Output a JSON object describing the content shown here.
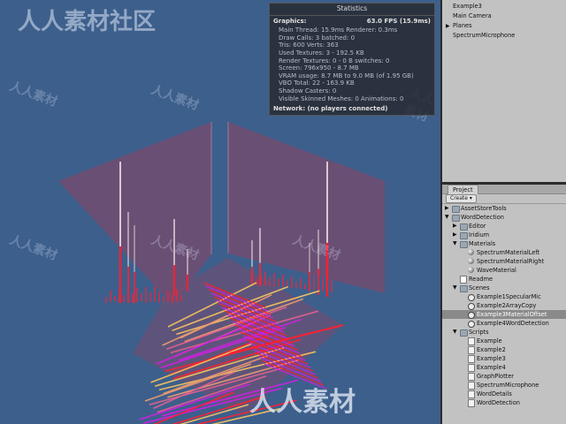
{
  "watermark": {
    "top_left": "人人素材社区",
    "center_bottom": "人人素材",
    "faint": "人人素材"
  },
  "stats": {
    "title": "Statistics",
    "graphics_label": "Graphics:",
    "fps": "63.0 FPS (15.9ms)",
    "lines": [
      "Main Thread: 15.9ms   Renderer: 0.3ms",
      "Draw Calls: 3   batched: 0",
      "Tris: 600   Verts: 363",
      "Used Textures: 3 - 192.5 KB",
      "Render Textures: 0 - 0 B   switches: 0",
      "Screen: 796x950 - 8.7 MB",
      "VRAM usage: 8.7 MB to 9.0 MB (of 1.95 GB)",
      "VBO Total: 22 - 163.9 KB",
      "Shadow Casters: 0",
      "Visible Skinned Meshes: 0       Animations: 0"
    ],
    "network": "Network: (no players connected)"
  },
  "hierarchy": {
    "items": [
      {
        "label": "Example3",
        "expandable": false
      },
      {
        "label": "Main Camera",
        "expandable": false
      },
      {
        "label": "Planes",
        "expandable": true
      },
      {
        "label": "SpectrumMicrophone",
        "expandable": false
      }
    ]
  },
  "project": {
    "tab_label": "Project",
    "create_label": "Create",
    "tree": [
      {
        "label": "AssetStoreTools",
        "depth": 0,
        "icon": "folder-icon",
        "arrow": "right"
      },
      {
        "label": "WordDetection",
        "depth": 0,
        "icon": "folder-icon",
        "arrow": "down"
      },
      {
        "label": "Editor",
        "depth": 1,
        "icon": "folder-icon",
        "arrow": "right"
      },
      {
        "label": "Iridium",
        "depth": 1,
        "icon": "folder-icon",
        "arrow": "right"
      },
      {
        "label": "Materials",
        "depth": 1,
        "icon": "folder-icon",
        "arrow": "down"
      },
      {
        "label": "SpectrumMaterialLeft",
        "depth": 2,
        "icon": "material-icon",
        "arrow": ""
      },
      {
        "label": "SpectrumMaterialRight",
        "depth": 2,
        "icon": "material-icon",
        "arrow": ""
      },
      {
        "label": "WaveMaterial",
        "depth": 2,
        "icon": "material-icon",
        "arrow": ""
      },
      {
        "label": "Readme",
        "depth": 1,
        "icon": "document-icon",
        "arrow": ""
      },
      {
        "label": "Scenes",
        "depth": 1,
        "icon": "folder-icon",
        "arrow": "down"
      },
      {
        "label": "Example1SpecularMic",
        "depth": 2,
        "icon": "scene-icon",
        "arrow": ""
      },
      {
        "label": "Example2ArrayCopy",
        "depth": 2,
        "icon": "scene-icon",
        "arrow": ""
      },
      {
        "label": "Example3MaterialOffset",
        "depth": 2,
        "icon": "scene-icon",
        "arrow": "",
        "selected": true
      },
      {
        "label": "Example4WordDetection",
        "depth": 2,
        "icon": "scene-icon",
        "arrow": ""
      },
      {
        "label": "Scripts",
        "depth": 1,
        "icon": "folder-icon",
        "arrow": "down"
      },
      {
        "label": "Example",
        "depth": 2,
        "icon": "script-icon",
        "arrow": ""
      },
      {
        "label": "Example2",
        "depth": 2,
        "icon": "script-icon",
        "arrow": ""
      },
      {
        "label": "Example3",
        "depth": 2,
        "icon": "script-icon",
        "arrow": ""
      },
      {
        "label": "Example4",
        "depth": 2,
        "icon": "script-icon",
        "arrow": ""
      },
      {
        "label": "GraphPlotter",
        "depth": 2,
        "icon": "script-icon",
        "arrow": ""
      },
      {
        "label": "SpectrumMicrophone",
        "depth": 2,
        "icon": "script-icon",
        "arrow": ""
      },
      {
        "label": "WordDetails",
        "depth": 2,
        "icon": "script-icon",
        "arrow": ""
      },
      {
        "label": "WordDetection",
        "depth": 2,
        "icon": "script-icon",
        "arrow": ""
      }
    ]
  },
  "colors": {
    "scene_background": "#3d5f8c",
    "panel_background": "#c2c2c2",
    "spectrum_hot": "#ff2030",
    "spectrum_warm": "#f0c060",
    "spectrum_magenta": "#d020e0",
    "wall": "#7a4a6e"
  }
}
